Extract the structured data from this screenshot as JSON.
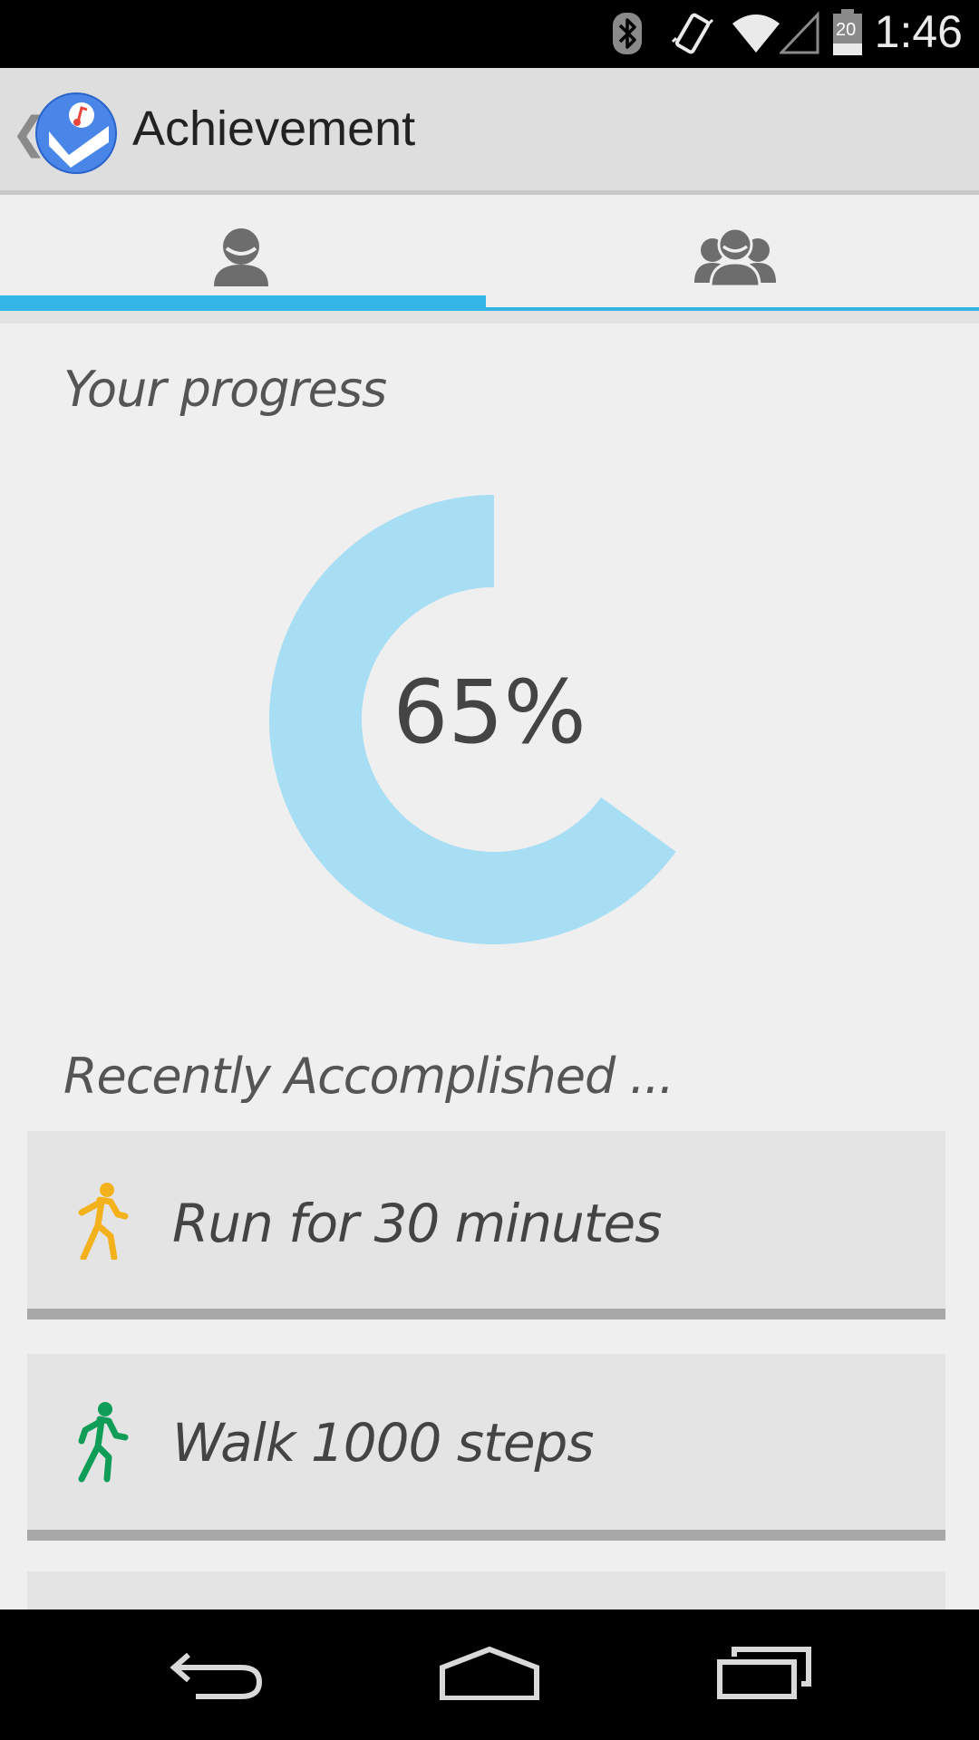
{
  "status_bar": {
    "time": "1:46",
    "battery_level": "20",
    "icons": [
      "bluetooth-icon",
      "vibrate-icon",
      "wifi-icon",
      "signal-icon",
      "battery-icon"
    ]
  },
  "action_bar": {
    "title": "Achievement",
    "back_icon": "chevron-left-icon",
    "app_icon": "app-logo-icon"
  },
  "tabs": [
    {
      "name": "personal",
      "icon": "person-icon",
      "selected": true
    },
    {
      "name": "group",
      "icon": "group-icon",
      "selected": false
    }
  ],
  "progress": {
    "heading": "Your progress",
    "value_text": "65%",
    "fraction": 0.65,
    "color": "#a8def4"
  },
  "recent": {
    "heading": "Recently Accomplished ...",
    "items": [
      {
        "label": "Run for 30 minutes",
        "icon": "running-person-icon",
        "icon_color": "#f3b21c"
      },
      {
        "label": "Walk 1000 steps",
        "icon": "walking-person-icon",
        "icon_color": "#0f9d58"
      }
    ]
  },
  "colors": {
    "accent": "#33b5e5",
    "background": "#efefef",
    "card": "#e4e4e4"
  },
  "nav_bar": {
    "buttons": [
      "back-icon",
      "home-icon",
      "recent-apps-icon"
    ]
  }
}
